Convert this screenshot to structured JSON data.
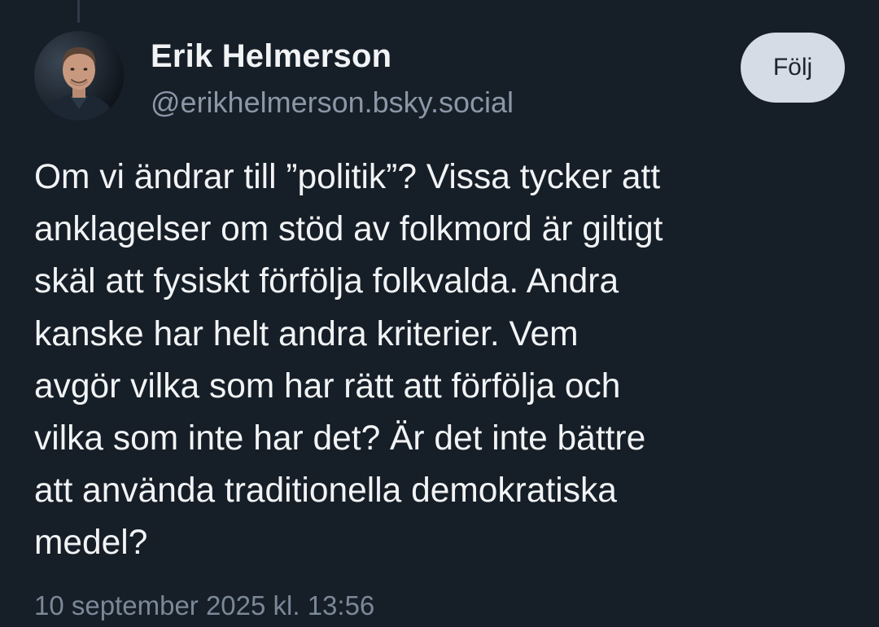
{
  "post": {
    "author": {
      "display_name": "Erik Helmerson",
      "handle": "@erikhelmerson.bsky.social",
      "avatar_icon": "profile-photo"
    },
    "follow_label": "Följ",
    "text_lines": [
      "Om vi ändrar till ”politik”? Vissa tycker att",
      "anklagelser om stöd av folkmord är giltigt",
      "skäl att fysiskt förfölja folkvalda. Andra",
      "kanske har helt andra kriterier. Vem",
      "avgör vilka som har rätt att förfölja och",
      "vilka som inte har det? Är det inte bättre",
      "att använda traditionella demokratiska",
      "medel?"
    ],
    "timestamp": "10 september 2025 kl. 13:56"
  },
  "colors": {
    "background": "#161e27",
    "text": "#f1f3f5",
    "muted": "#8a97a7",
    "button_bg": "#d5dce5"
  }
}
